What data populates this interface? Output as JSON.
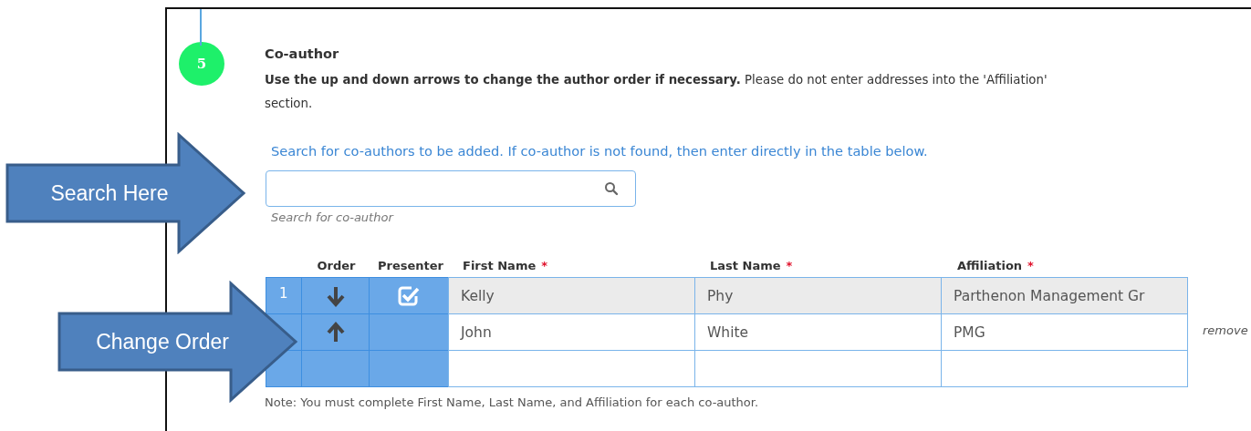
{
  "step": {
    "number": "5",
    "title": "Co-author"
  },
  "instructions": "**Use the up and down arrows to change the author order if necessary.** Please do not enter addresses into the 'Affiliation' section.",
  "search": {
    "prompt": "Search for co-authors to be added. If co-author is not found, then enter directly in the table below.",
    "hint": "Search for co-author"
  },
  "table": {
    "columns": [
      {
        "label": "Order",
        "required": false
      },
      {
        "label": "Presenter",
        "required": false
      },
      {
        "label": "First Name",
        "required": true
      },
      {
        "label": "Last Name",
        "required": true
      },
      {
        "label": "Affiliation",
        "required": true
      }
    ],
    "required_mark": "*",
    "rows": [
      {
        "number": "1",
        "kind": "down-arrow",
        "presenter": true,
        "highlighted": true,
        "first_name": "Kelly",
        "last_name": "Phy",
        "affiliation": "Parthenon Management Gr"
      },
      {
        "kind": "up-arrow",
        "presenter": false,
        "highlighted": false,
        "first_name": "John",
        "last_name": "White",
        "affiliation": "PMG",
        "action": "remove"
      },
      {
        "kind": "blank",
        "presenter": false,
        "highlighted": false
      }
    ]
  },
  "note": "Note: You must complete First Name, Last Name, and Affiliation for each co-author.",
  "callouts": [
    {
      "label": "Search Here"
    },
    {
      "label": "Change Order"
    }
  ]
}
